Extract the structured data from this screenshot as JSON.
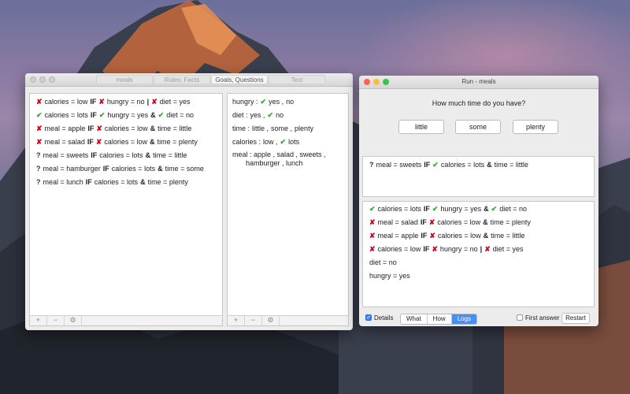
{
  "main_window": {
    "tabs": [
      {
        "label": "meals"
      },
      {
        "label": "Rules, Facts"
      },
      {
        "label": "Goals, Questions"
      },
      {
        "label": "Text"
      }
    ],
    "rules": [
      [
        {
          "t": "x"
        },
        {
          "t": "text",
          "v": "calories = low"
        },
        {
          "t": "kw",
          "v": "IF"
        },
        {
          "t": "x"
        },
        {
          "t": "text",
          "v": "hungry = no"
        },
        {
          "t": "kw",
          "v": "|"
        },
        {
          "t": "x"
        },
        {
          "t": "text",
          "v": "diet = yes"
        }
      ],
      [
        {
          "t": "ok"
        },
        {
          "t": "text",
          "v": "calories = lots"
        },
        {
          "t": "kw",
          "v": "IF"
        },
        {
          "t": "ok"
        },
        {
          "t": "text",
          "v": "hungry = yes"
        },
        {
          "t": "kw",
          "v": "&"
        },
        {
          "t": "ok"
        },
        {
          "t": "text",
          "v": "diet = no"
        }
      ],
      [
        {
          "t": "x"
        },
        {
          "t": "text",
          "v": "meal = apple"
        },
        {
          "t": "kw",
          "v": "IF"
        },
        {
          "t": "x"
        },
        {
          "t": "text",
          "v": "calories = low"
        },
        {
          "t": "kw",
          "v": "&"
        },
        {
          "t": "text",
          "v": "time = little"
        }
      ],
      [
        {
          "t": "x"
        },
        {
          "t": "text",
          "v": "meal = salad"
        },
        {
          "t": "kw",
          "v": "IF"
        },
        {
          "t": "x"
        },
        {
          "t": "text",
          "v": "calories = low"
        },
        {
          "t": "kw",
          "v": "&"
        },
        {
          "t": "text",
          "v": "time = plenty"
        }
      ],
      [
        {
          "t": "q"
        },
        {
          "t": "text",
          "v": "meal = sweets"
        },
        {
          "t": "kw",
          "v": "IF"
        },
        {
          "t": "text",
          "v": "calories = lots"
        },
        {
          "t": "kw",
          "v": "&"
        },
        {
          "t": "text",
          "v": "time = little"
        }
      ],
      [
        {
          "t": "q"
        },
        {
          "t": "text",
          "v": "meal = hamburger"
        },
        {
          "t": "kw",
          "v": "IF"
        },
        {
          "t": "text",
          "v": "calories = lots"
        },
        {
          "t": "kw",
          "v": "&"
        },
        {
          "t": "text",
          "v": "time = some"
        }
      ],
      [
        {
          "t": "q"
        },
        {
          "t": "text",
          "v": "meal = lunch"
        },
        {
          "t": "kw",
          "v": "IF"
        },
        {
          "t": "text",
          "v": "calories = lots"
        },
        {
          "t": "kw",
          "v": "&"
        },
        {
          "t": "text",
          "v": "time = plenty"
        }
      ]
    ],
    "facts": [
      [
        {
          "t": "text",
          "v": "hungry :"
        },
        {
          "t": "ok"
        },
        {
          "t": "text",
          "v": "yes ,"
        },
        {
          "t": "text",
          "v": "no"
        }
      ],
      [
        {
          "t": "text",
          "v": "diet :"
        },
        {
          "t": "text",
          "v": "yes ,"
        },
        {
          "t": "ok"
        },
        {
          "t": "text",
          "v": "no"
        }
      ],
      [
        {
          "t": "text",
          "v": "time :"
        },
        {
          "t": "text",
          "v": "little ,"
        },
        {
          "t": "text",
          "v": "some ,"
        },
        {
          "t": "text",
          "v": "plenty"
        }
      ],
      [
        {
          "t": "text",
          "v": "calories :"
        },
        {
          "t": "text",
          "v": "low ,"
        },
        {
          "t": "ok"
        },
        {
          "t": "text",
          "v": "lots"
        }
      ]
    ],
    "meal_line1": "meal :  apple ,  salad ,  sweets ,",
    "meal_line2": "hamburger ,  lunch",
    "footer_buttons": [
      "+",
      "−",
      "⚙"
    ]
  },
  "run_window": {
    "title": "Run - meals",
    "question": "How much time do you have?",
    "answers": [
      "little",
      "some",
      "plenty"
    ],
    "current_rule": [
      {
        "t": "q"
      },
      {
        "t": "text",
        "v": "meal = sweets"
      },
      {
        "t": "kw",
        "v": "IF"
      },
      {
        "t": "ok"
      },
      {
        "t": "text",
        "v": "calories = lots"
      },
      {
        "t": "kw",
        "v": "&"
      },
      {
        "t": "text",
        "v": "time = little"
      }
    ],
    "log": [
      [
        {
          "t": "ok"
        },
        {
          "t": "text",
          "v": "calories = lots"
        },
        {
          "t": "kw",
          "v": "IF"
        },
        {
          "t": "ok"
        },
        {
          "t": "text",
          "v": "hungry = yes"
        },
        {
          "t": "kw",
          "v": "&"
        },
        {
          "t": "ok"
        },
        {
          "t": "text",
          "v": "diet = no"
        }
      ],
      [
        {
          "t": "x"
        },
        {
          "t": "text",
          "v": "meal = salad"
        },
        {
          "t": "kw",
          "v": "IF"
        },
        {
          "t": "x"
        },
        {
          "t": "text",
          "v": "calories = low"
        },
        {
          "t": "kw",
          "v": "&"
        },
        {
          "t": "text",
          "v": "time = plenty"
        }
      ],
      [
        {
          "t": "x"
        },
        {
          "t": "text",
          "v": "meal = apple"
        },
        {
          "t": "kw",
          "v": "IF"
        },
        {
          "t": "x"
        },
        {
          "t": "text",
          "v": "calories = low"
        },
        {
          "t": "kw",
          "v": "&"
        },
        {
          "t": "text",
          "v": "time = little"
        }
      ],
      [
        {
          "t": "x"
        },
        {
          "t": "text",
          "v": "calories = low"
        },
        {
          "t": "kw",
          "v": "IF"
        },
        {
          "t": "x"
        },
        {
          "t": "text",
          "v": "hungry = no"
        },
        {
          "t": "kw",
          "v": "|"
        },
        {
          "t": "x"
        },
        {
          "t": "text",
          "v": "diet = yes"
        }
      ],
      [
        {
          "t": "text",
          "v": "diet = no"
        }
      ],
      [
        {
          "t": "text",
          "v": "hungry = yes"
        }
      ]
    ],
    "details_label": "Details",
    "segments": [
      "What",
      "How",
      "Logs"
    ],
    "selected_segment": "Logs",
    "first_answer_label": "First answer",
    "restart_label": "Restart"
  },
  "colors": {
    "accent": "#4a8ef0",
    "fail": "#d0021b",
    "pass": "#2ea82e"
  },
  "icons": {
    "fail": "cross-icon",
    "pass": "checkmark-icon",
    "unknown": "question-icon"
  }
}
